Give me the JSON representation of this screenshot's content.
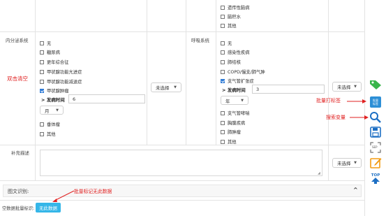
{
  "top_block": {
    "items": [
      {
        "label": "遗传性脑病",
        "checked": false
      },
      {
        "label": "脑积水",
        "checked": false
      },
      {
        "label": "其他",
        "checked": false
      }
    ]
  },
  "endocrine": {
    "label": "内分泌系统",
    "items": [
      {
        "label": "无",
        "checked": false
      },
      {
        "label": "糖尿病",
        "checked": false
      },
      {
        "label": "更年综合征",
        "checked": false
      },
      {
        "label": "甲状腺功能亢进症",
        "checked": false
      },
      {
        "label": "甲状腺功能减退症",
        "checked": false
      },
      {
        "label": "甲状腺肿瘤",
        "checked": true
      }
    ],
    "duration_label": "> 发病时间",
    "duration_value": "6",
    "unit": "月",
    "items_after": [
      {
        "label": "垂体瘤",
        "checked": false
      },
      {
        "label": "其他",
        "checked": false
      }
    ],
    "select": "未选择"
  },
  "respiratory": {
    "label": "呼吸系统",
    "items": [
      {
        "label": "无",
        "checked": false
      },
      {
        "label": "感染性疾病",
        "checked": false
      },
      {
        "label": "肺结核",
        "checked": false
      },
      {
        "label": "COPD/慢支/肺气肿",
        "checked": false
      },
      {
        "label": "支气管扩张症",
        "checked": true
      }
    ],
    "duration_label": "> 发病时间",
    "duration_value": "3",
    "unit": "年",
    "items_after": [
      {
        "label": "支气管哮喘",
        "checked": false
      },
      {
        "label": "胸膜疾病",
        "checked": false
      },
      {
        "label": "肺肿瘤",
        "checked": false
      },
      {
        "label": "其他",
        "checked": false
      }
    ],
    "select": "未选择"
  },
  "supplement": {
    "label": "补充描述",
    "select": "未选择"
  },
  "ocr": {
    "label": "图文识别:",
    "chevron": "^"
  },
  "empty_batch": {
    "label": "空数据批量标识:",
    "button": "无此数据"
  },
  "annotations": {
    "double_click_clear": "双击清空",
    "batch_tag": "批量打标签",
    "search_var": "搜索变量",
    "batch_mark_empty": "批量标记无此数据"
  },
  "toolbar": {
    "batch_label_line1": "批量",
    "batch_label_line2": "标签",
    "sep_label": "SEP",
    "top_label": "TOP"
  }
}
